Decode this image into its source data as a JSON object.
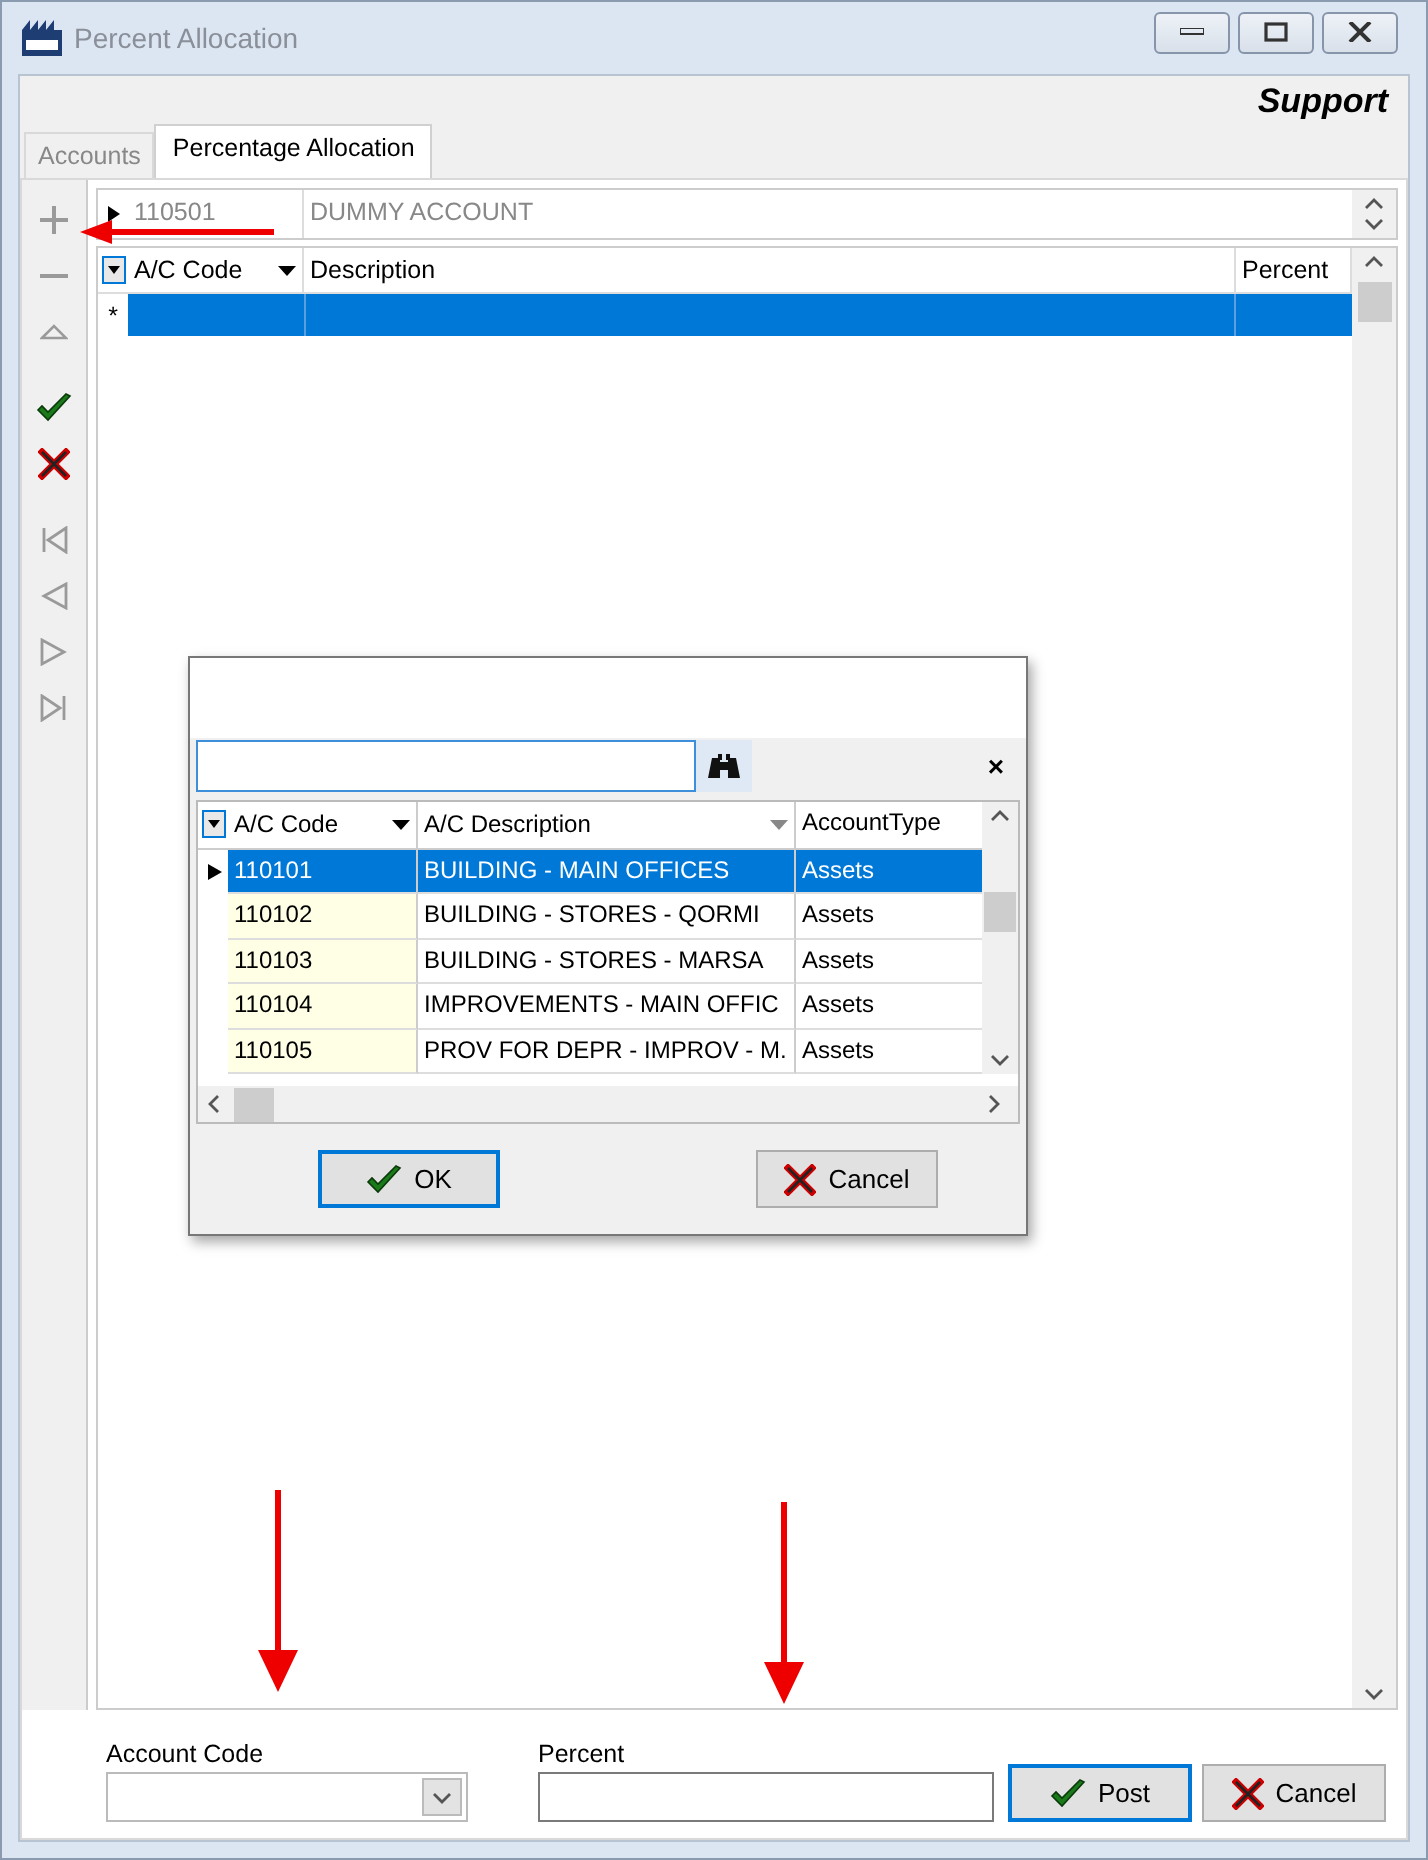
{
  "window": {
    "title": "Percent Allocation",
    "caption_label": "Support"
  },
  "tabs": [
    {
      "label": "Accounts",
      "selected": false
    },
    {
      "label": "Percentage Allocation",
      "selected": true
    }
  ],
  "toolbar": [
    {
      "kind": "add",
      "disabled": true
    },
    {
      "kind": "remove",
      "disabled": true
    },
    {
      "kind": "up",
      "disabled": true
    },
    {
      "kind": "confirm",
      "disabled": false
    },
    {
      "kind": "cancel",
      "disabled": false
    },
    {
      "kind": "first",
      "disabled": true
    },
    {
      "kind": "previous",
      "disabled": true
    },
    {
      "kind": "next",
      "disabled": true
    },
    {
      "kind": "last",
      "disabled": true
    }
  ],
  "master_row": {
    "code": "110501",
    "description": "DUMMY ACCOUNT"
  },
  "grid": {
    "columns": [
      "A/C Code",
      "Description",
      "Percent"
    ],
    "new_row_marker": "*"
  },
  "lookup": {
    "columns": [
      "A/C Code",
      "A/C Description",
      "AccountType"
    ],
    "rows": [
      {
        "code": "110101",
        "description": "BUILDING - MAIN OFFICES",
        "type": "Assets",
        "selected": true
      },
      {
        "code": "110102",
        "description": "BUILDING - STORES - QORMI",
        "type": "Assets",
        "selected": false
      },
      {
        "code": "110103",
        "description": "BUILDING - STORES - MARSA",
        "type": "Assets",
        "selected": false
      },
      {
        "code": "110104",
        "description": "IMPROVEMENTS - MAIN OFFIC",
        "type": "Assets",
        "selected": false
      },
      {
        "code": "110105",
        "description": "PROV FOR DEPR - IMPROV - M.",
        "type": "Assets",
        "selected": false
      }
    ],
    "close_glyph": "×",
    "buttons": [
      {
        "kind": "ok",
        "label": "OK"
      },
      {
        "kind": "cancel",
        "label": "Cancel"
      }
    ]
  },
  "form": {
    "account_code_label": "Account Code",
    "percent_label": "Percent",
    "buttons": [
      {
        "kind": "post",
        "label": "Post"
      },
      {
        "kind": "cancel",
        "label": "Cancel"
      }
    ]
  }
}
